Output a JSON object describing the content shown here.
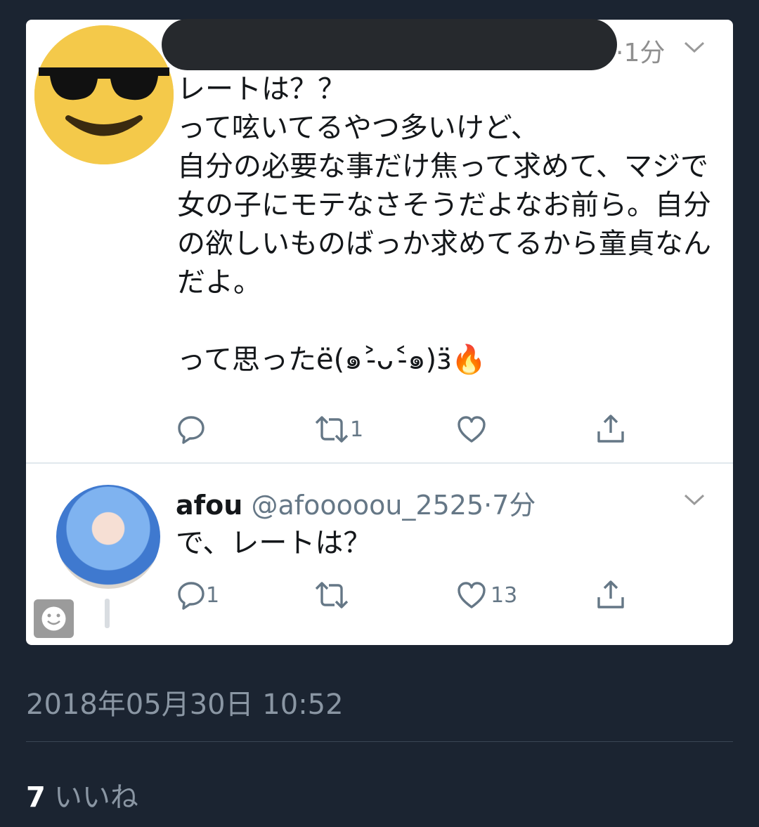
{
  "tweet": {
    "time": "·1分",
    "avatar_icon": "sunglasses-face-icon",
    "text": "レートは？？\nって呟いてるやつ多いけど、\n自分の必要な事だけ焦って求めて、マジで女の子にモテなさそうだよなお前ら。自分の欲しいものばっか求めてるから童貞なんだよ。\n\nって思ったё(๑˃̵ᴗ˂̵๑)ӟ🔥",
    "retweet_count": "1"
  },
  "reply": {
    "name": "afou",
    "handle": "@afooooou_2525",
    "time": "·7分",
    "text": "で、レートは？",
    "reply_count": "1",
    "like_count": "13"
  },
  "footer": {
    "date": "2018年05月30日 10:52",
    "like_count": "7",
    "like_label": "いいね"
  },
  "colors": {
    "background": "#1b2431",
    "card": "#ffffff",
    "icon": "#657786"
  }
}
